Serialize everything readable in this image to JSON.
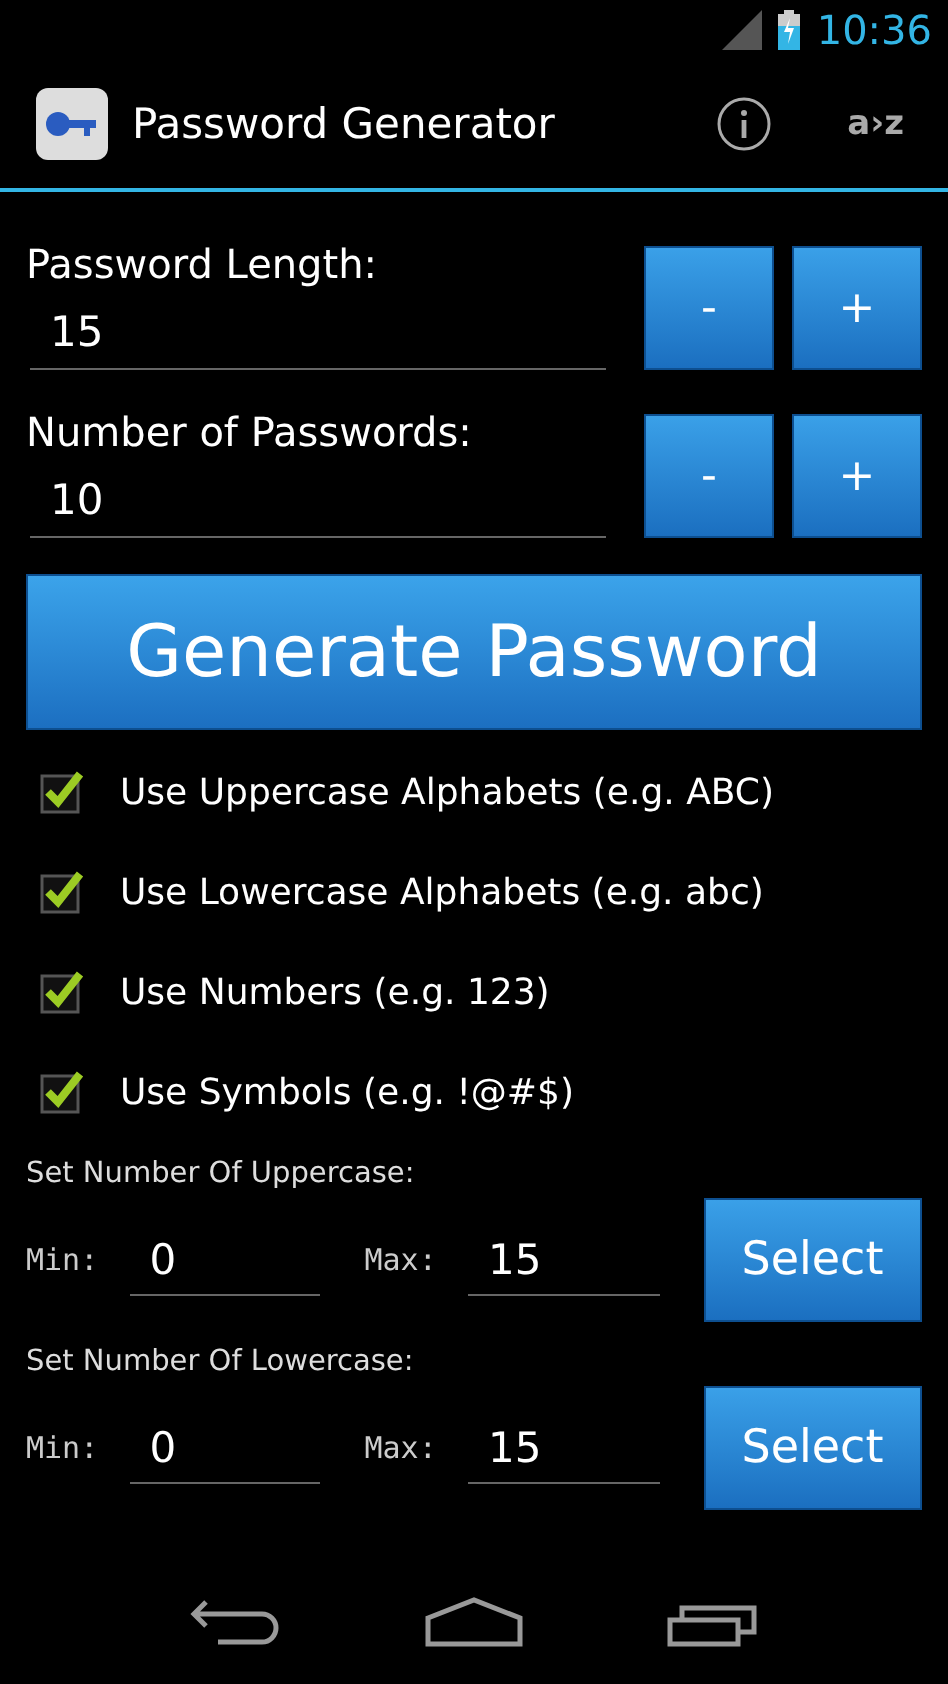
{
  "status_bar": {
    "time": "10:36"
  },
  "action_bar": {
    "title": "Password Generator",
    "sort_label": "a›z"
  },
  "inputs": [
    {
      "label": "Password Length:",
      "value": "15",
      "buttons": [
        "-",
        "+"
      ]
    },
    {
      "label": "Number of Passwords:",
      "value": "10",
      "buttons": [
        "-",
        "+"
      ]
    }
  ],
  "generate_button": "Generate Password",
  "options": [
    {
      "label": "Use Uppercase Alphabets (e.g. ABC)",
      "checked": true
    },
    {
      "label": "Use Lowercase Alphabets (e.g. abc)",
      "checked": true
    },
    {
      "label": "Use Numbers (e.g. 123)",
      "checked": true
    },
    {
      "label": "Use Symbols (e.g. !@#$)",
      "checked": true
    }
  ],
  "ranges": [
    {
      "title": "Set Number Of Uppercase:",
      "min_label": "Min:",
      "min": "0",
      "max_label": "Max:",
      "max": "15",
      "button": "Select"
    },
    {
      "title": "Set Number Of Lowercase:",
      "min_label": "Min:",
      "min": "0",
      "max_label": "Max:",
      "max": "15",
      "button": "Select"
    }
  ]
}
